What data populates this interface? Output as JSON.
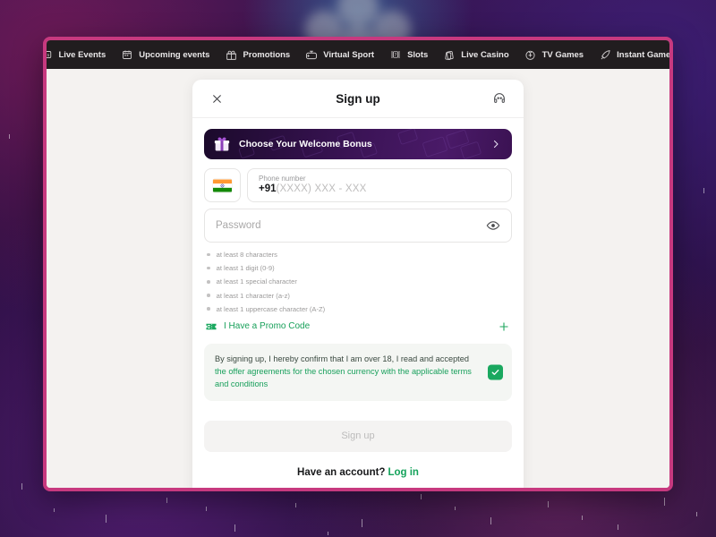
{
  "nav": {
    "items": [
      {
        "label": "Live Events",
        "icon": "live-events-icon"
      },
      {
        "label": "Upcoming events",
        "icon": "calendar-icon"
      },
      {
        "label": "Promotions",
        "icon": "gift-icon"
      },
      {
        "label": "Virtual Sport",
        "icon": "virtual-sport-icon"
      },
      {
        "label": "Slots",
        "icon": "slots-icon"
      },
      {
        "label": "Live Casino",
        "icon": "live-casino-icon"
      },
      {
        "label": "TV Games",
        "icon": "tv-games-icon"
      },
      {
        "label": "Instant Games",
        "icon": "instant-games-icon"
      }
    ]
  },
  "modal": {
    "title": "Sign up",
    "close_icon": "close-icon",
    "support_icon": "headset-icon",
    "bonus_banner": {
      "label": "Choose Your Welcome Bonus",
      "icon": "gift-icon",
      "chevron": "chevron-right-icon"
    },
    "phone": {
      "country_flag": "india-flag-icon",
      "label": "Phone number",
      "prefix": "+91",
      "placeholder": "(XXXX) XXX - XXX"
    },
    "password": {
      "placeholder": "Password",
      "toggle_icon": "eye-icon",
      "requirements": [
        "at least 8 characters",
        "at least 1 digit (0-9)",
        "at least 1 special character",
        "at least 1 character (a-z)",
        "at least 1 uppercase character (A-Z)"
      ]
    },
    "promo": {
      "label": "I Have a Promo Code",
      "icon": "ticket-icon",
      "add_icon": "plus-icon"
    },
    "terms": {
      "line1": "By signing up, I hereby confirm that I am over 18, I read and accepted",
      "link": "the offer agreements for the chosen currency with the applicable",
      "line3": "terms and conditions",
      "checked": true,
      "check_icon": "check-icon"
    },
    "submit_label": "Sign up",
    "footer": {
      "prompt": "Have an account?",
      "link": "Log in"
    }
  },
  "colors": {
    "frame_border": "#c7397f",
    "nav_background": "#211d1f",
    "accent_green": "#19a05c",
    "banner_purple": "#3a1355"
  }
}
